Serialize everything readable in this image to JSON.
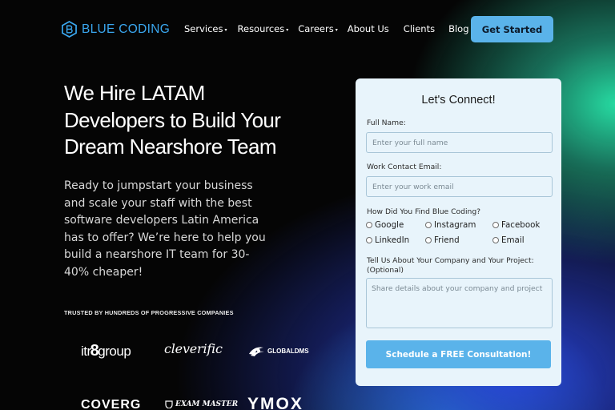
{
  "brand": {
    "name": "BLUE CODING",
    "icon": "hexagon-b-logo",
    "color": "#3aa7ef"
  },
  "nav": {
    "items": [
      {
        "label": "Services",
        "dropdown": true
      },
      {
        "label": "Resources",
        "dropdown": true
      },
      {
        "label": "Careers",
        "dropdown": true
      },
      {
        "label": "About Us",
        "dropdown": false
      },
      {
        "label": "Clients",
        "dropdown": false
      },
      {
        "label": "Blog",
        "dropdown": false
      }
    ],
    "caret": "▾",
    "cta": "Get Started"
  },
  "hero": {
    "title_lines": [
      "We Hire LATAM",
      "Developers to Build Your",
      "Dream Nearshore Team"
    ],
    "subtitle_lines": [
      "Ready to jumpstart your business",
      "and scale your staff with the best",
      "software developers Latin America",
      "has to offer? We’re here to help you",
      "build a nearshore IT team for 30-",
      "40% cheaper!"
    ],
    "trusted": "TRUSTED BY HUNDREDS OF PROGRESSIVE COMPANIES"
  },
  "logos": {
    "itr": {
      "pre": "itr",
      "mid": "8",
      "post": "group"
    },
    "cleverific": "cleverific",
    "globaldms": "GLOBALDMS",
    "coverg": "COVERG",
    "exam": "EXAM MASTER",
    "ymox": "YMOX"
  },
  "form": {
    "title": "Let's Connect!",
    "full_name": {
      "label": "Full Name:",
      "placeholder": "Enter your full name"
    },
    "email": {
      "label": "Work Contact Email:",
      "placeholder": "Enter your work email"
    },
    "source": {
      "label": "How Did You Find Blue Coding?",
      "options": [
        "Google",
        "Instagram",
        "Facebook",
        "LinkedIn",
        "Friend",
        "Email"
      ]
    },
    "project": {
      "label_line1": "Tell Us About Your Company and Your Project:",
      "label_line2": "(Optional)",
      "placeholder": "Share details about your company and project"
    },
    "submit": "Schedule a FREE Consultation!"
  },
  "colors": {
    "accent": "#5ab3ea",
    "form_bg": "#e8f4fb",
    "page_bg": "#050505"
  }
}
